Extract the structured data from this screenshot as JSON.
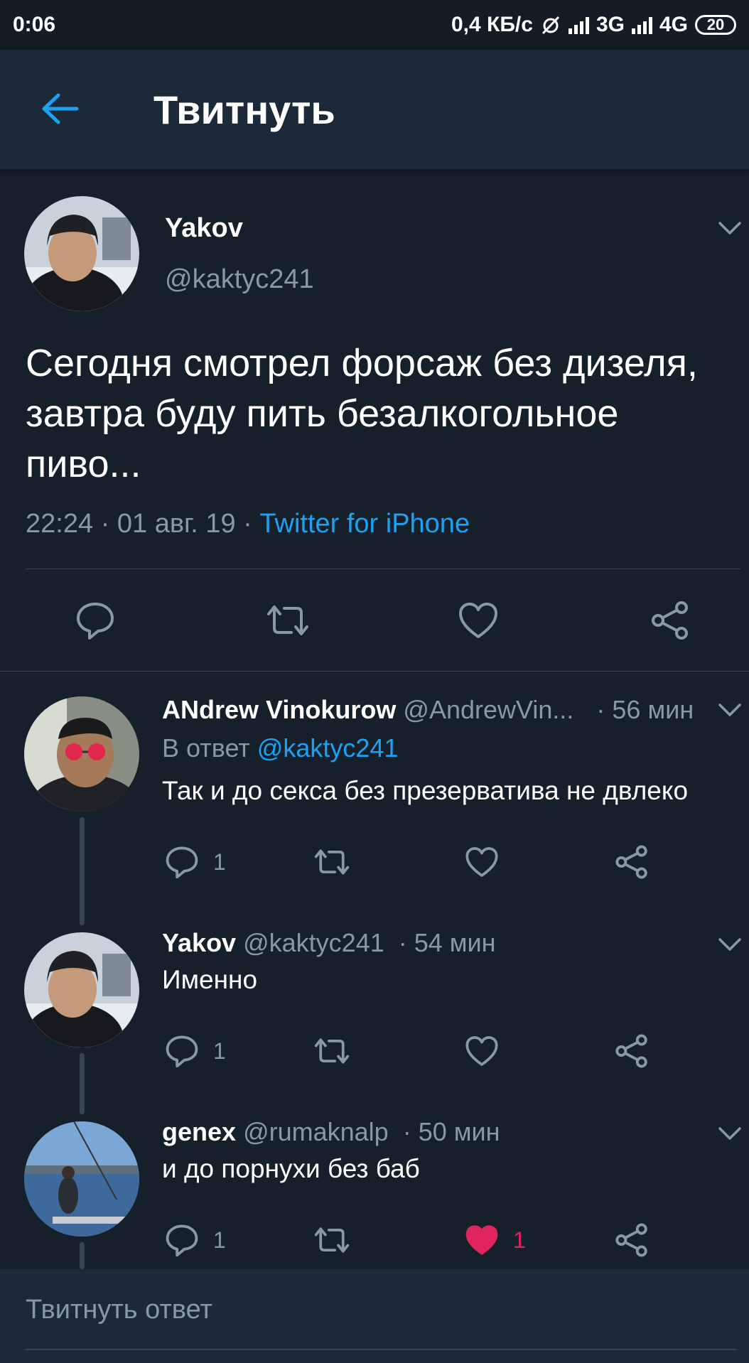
{
  "status_bar": {
    "time": "0:06",
    "net_speed": "0,4 КБ/с",
    "net1": "3G",
    "net2": "4G",
    "battery": "20"
  },
  "header": {
    "title": "Твитнуть",
    "back_icon": "arrow-left-icon"
  },
  "main_tweet": {
    "name": "Yakov",
    "handle": "@kaktyc241",
    "text": "Сегодня смотрел форсаж без дизеля, завтра буду пить безалкогольное пиво...",
    "time": "22:24 · 01 авг. 19 · ",
    "source": "Twitter for iPhone"
  },
  "replies": [
    {
      "name": "ANdrew Vinokurow",
      "handle": "@AndrewVin...",
      "time": "· 56 мин",
      "reply_prefix": "В ответ ",
      "reply_to": "@kaktyc241",
      "text": "Так и до секса без презерватива не двлеко",
      "reply_count": "1",
      "like_count": ""
    },
    {
      "name": "Yakov",
      "handle": "@kaktyc241",
      "time": "· 54 мин",
      "text": "Именно",
      "reply_count": "1",
      "like_count": ""
    },
    {
      "name": "genex",
      "handle": "@rumaknalp",
      "time": "· 50 мин",
      "text": "и до порнухи без баб",
      "reply_count": "1",
      "like_count": "1"
    }
  ],
  "compose": {
    "placeholder": "Твитнуть ответ"
  },
  "colors": {
    "background": "#15202b",
    "accent": "#1da1f2",
    "like": "#e0245e",
    "muted": "#8899a6"
  }
}
